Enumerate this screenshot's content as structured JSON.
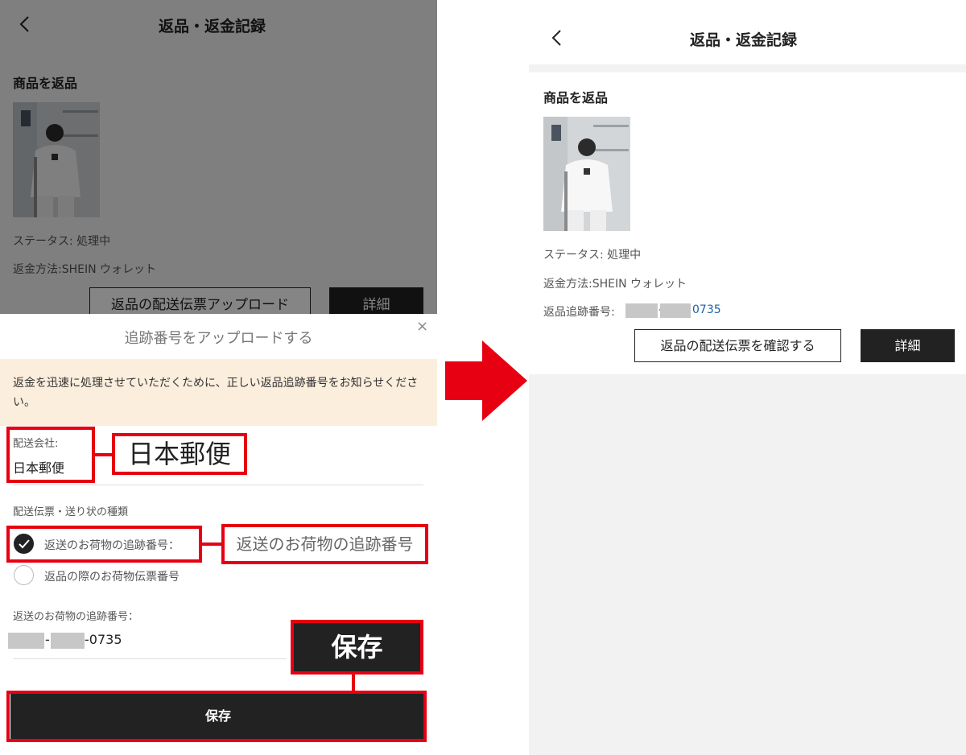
{
  "left": {
    "header": {
      "title": "返品・返金記録"
    },
    "section_title": "商品を返品",
    "status": "ステータス: 処理中",
    "refund_method": "返金方法:SHEIN ウォレット",
    "upload_button": "返品の配送伝票アップロード",
    "detail_button": "詳細",
    "modal": {
      "title": "追跡番号をアップロードする",
      "close": "×",
      "notice": "返金を迅速に処理させていただくために、正しい返品追跡番号をお知らせください。",
      "carrier_label": "配送会社:",
      "carrier_value": "日本郵便",
      "slip_type_label": "配送伝票・送り状の種類",
      "option_1": "返送のお荷物の追跡番号：",
      "option_2": "返品の際のお荷物伝票番号",
      "option_1_selected": true,
      "tracking_label": "返送のお荷物の追跡番号：",
      "tracking_suffix": "-0735",
      "save_button": "保存"
    },
    "callouts": {
      "carrier": "日本郵便",
      "tracking_type": "返送のお荷物の追跡番号",
      "save": "保存"
    }
  },
  "right": {
    "header": {
      "title": "返品・返金記録"
    },
    "section_title": "商品を返品",
    "status": "ステータス: 処理中",
    "refund_method": "返金方法:SHEIN ウォレット",
    "tracking_label": "返品追跡番号:",
    "tracking_suffix": "0735",
    "confirm_button": "返品の配送伝票を確認する",
    "detail_button": "詳細"
  },
  "colors": {
    "annotation_red": "#e60012",
    "dark_button": "#222222",
    "notice_bg": "#fbeedd",
    "link_blue": "#1a5fa8"
  },
  "icons": [
    "back-icon",
    "close-icon",
    "check-icon",
    "arrow-right-icon"
  ]
}
